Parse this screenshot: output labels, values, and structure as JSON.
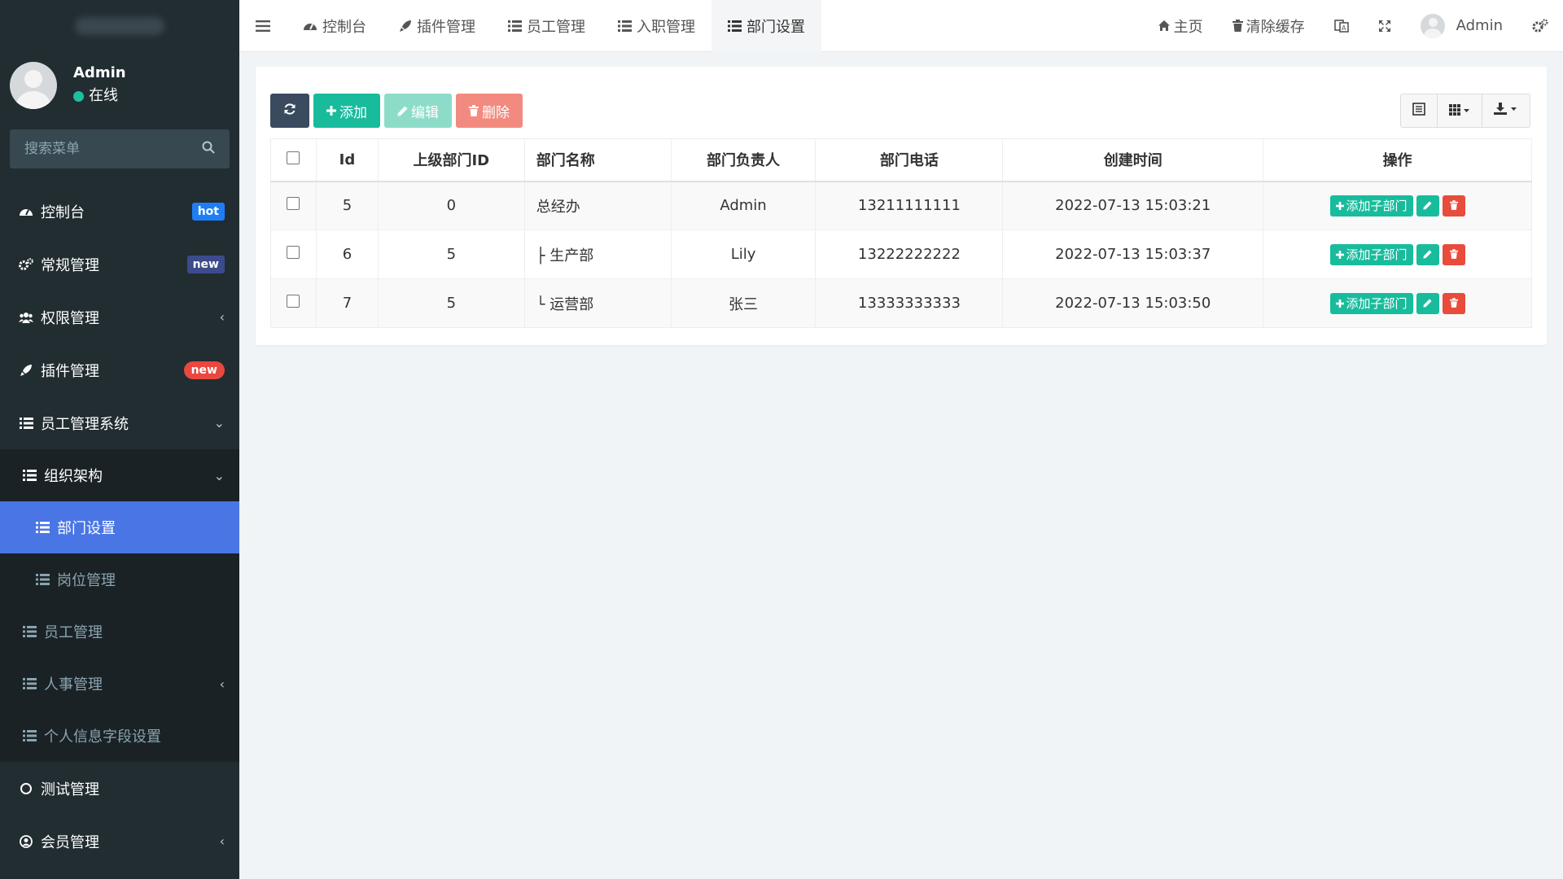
{
  "sidebar": {
    "user": {
      "name": "Admin",
      "status": "在线"
    },
    "search_placeholder": "搜索菜单",
    "items": [
      {
        "label": "控制台",
        "badge": "hot"
      },
      {
        "label": "常规管理",
        "badge": "new"
      },
      {
        "label": "权限管理"
      },
      {
        "label": "插件管理",
        "badge": "new"
      },
      {
        "label": "员工管理系统"
      }
    ],
    "org": {
      "label": "组织架构",
      "children": [
        {
          "label": "部门设置",
          "active": true
        },
        {
          "label": "岗位管理"
        }
      ]
    },
    "sub_items": [
      {
        "label": "员工管理"
      },
      {
        "label": "人事管理"
      },
      {
        "label": "个人信息字段设置"
      }
    ],
    "bottom_items": [
      {
        "label": "测试管理"
      },
      {
        "label": "会员管理"
      }
    ]
  },
  "topnav": {
    "tabs": [
      {
        "label": "控制台",
        "icon": "dashboard-icon"
      },
      {
        "label": "插件管理",
        "icon": "rocket-icon"
      },
      {
        "label": "员工管理",
        "icon": "list-icon"
      },
      {
        "label": "入职管理",
        "icon": "list-icon"
      },
      {
        "label": "部门设置",
        "icon": "list-icon",
        "active": true
      }
    ],
    "home": "主页",
    "clear_cache": "清除缓存",
    "user": "Admin"
  },
  "toolbar": {
    "add": "添加",
    "edit": "编辑",
    "delete": "删除"
  },
  "table": {
    "headers": [
      "Id",
      "上级部门ID",
      "部门名称",
      "部门负责人",
      "部门电话",
      "创建时间",
      "操作"
    ],
    "rows": [
      {
        "id": "5",
        "pid": "0",
        "name": "总经办",
        "leader": "Admin",
        "phone": "13211111111",
        "created": "2022-07-13 15:03:21"
      },
      {
        "id": "6",
        "pid": "5",
        "name": "├ 生产部",
        "leader": "Lily",
        "phone": "13222222222",
        "created": "2022-07-13 15:03:37"
      },
      {
        "id": "7",
        "pid": "5",
        "name": "└ 运营部",
        "leader": "张三",
        "phone": "13333333333",
        "created": "2022-07-13 15:03:50"
      }
    ],
    "op_add_label": "添加子部门"
  },
  "colors": {
    "sidebar_bg": "#222d32",
    "active_menu": "#4a75e5",
    "success": "#18bc9c",
    "danger": "#e74c3c",
    "toolbar_dark": "#3a4a5f"
  }
}
